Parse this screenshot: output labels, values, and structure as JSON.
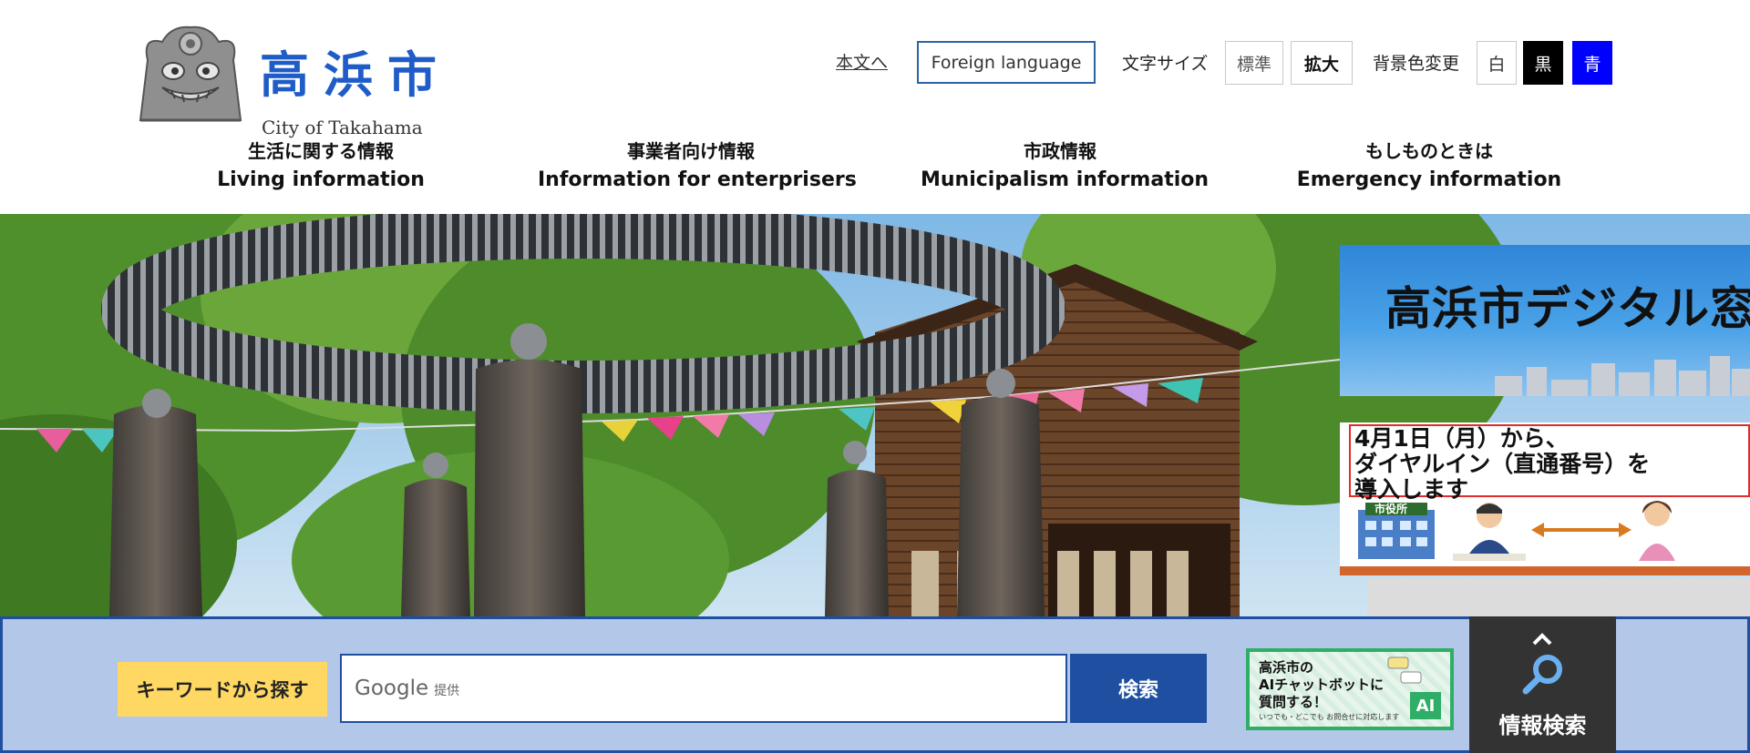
{
  "header": {
    "logo": {
      "title": "高浜市",
      "subtitle": "City of Takahama"
    },
    "skip_link": "本文へ",
    "foreign_language": "Foreign language",
    "text_size": {
      "label": "文字サイズ",
      "standard": "標準",
      "large": "拡大"
    },
    "bg_color": {
      "label": "背景色変更",
      "white": "白",
      "black": "黒",
      "blue": "青"
    }
  },
  "nav": [
    {
      "jp": "生活に関する情報",
      "en": "Living information"
    },
    {
      "jp": "事業者向け情報",
      "en": "Information for enterprisers"
    },
    {
      "jp": "市政情報",
      "en": "Municipalism information"
    },
    {
      "jp": "もしものときは",
      "en": "Emergency information"
    }
  ],
  "hero": {
    "banner_digital": "高浜市デジタル窓口",
    "banner_dial": {
      "line1": "4月1日（月）から、",
      "line2": "ダイヤルイン（直通番号）を",
      "line3": "導入します",
      "building": "市役所"
    }
  },
  "search": {
    "label": "キーワードから探す",
    "google": "Google",
    "google_sub": "提供",
    "button": "検索",
    "ai_banner": {
      "line1": "高浜市の",
      "line2": "AIチャットボットに",
      "line3": "質問する！",
      "small": "いつでも・どこでも お問合せに対応します",
      "badge": "AI"
    },
    "info_search": "情報検索"
  },
  "colors": {
    "accent": "#1e4fa0",
    "logo_blue": "#1f5cc8",
    "search_bg": "#b3c7e8",
    "label_yellow": "#ffd863"
  }
}
